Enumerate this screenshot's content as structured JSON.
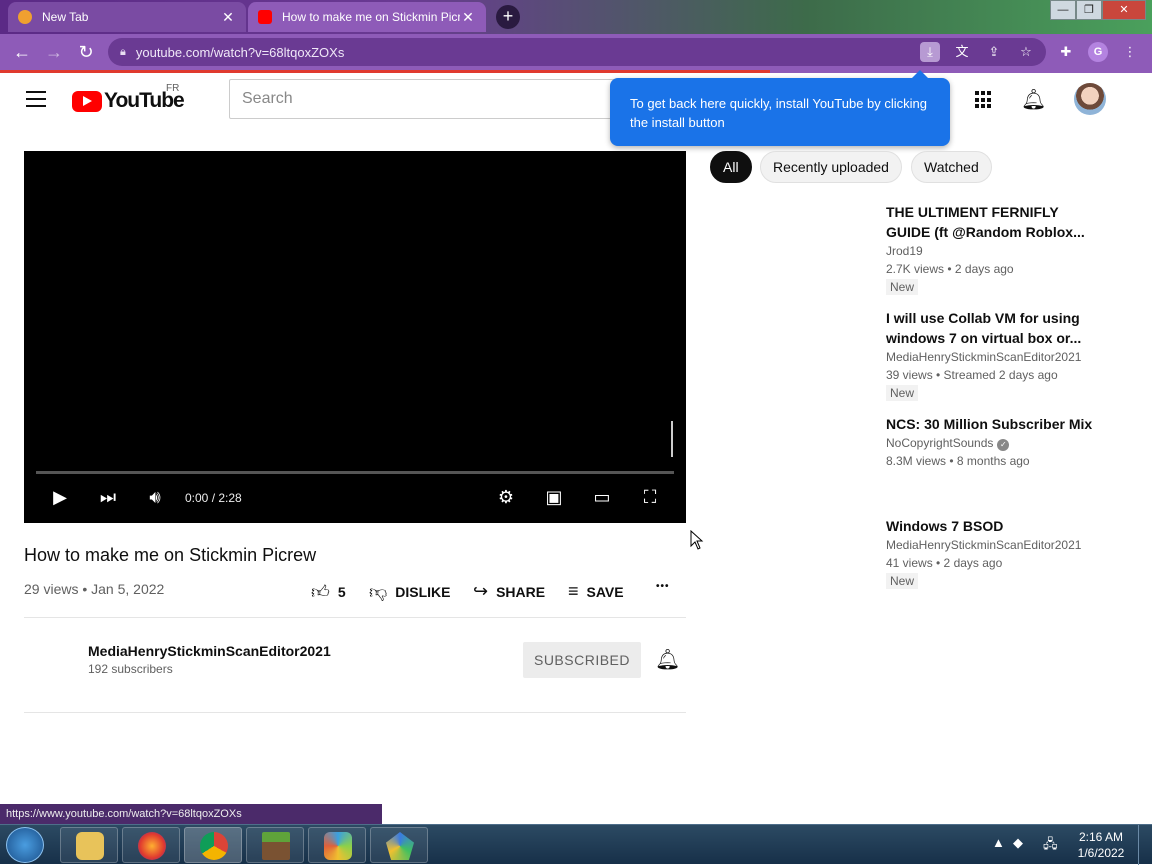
{
  "browser": {
    "tabs": [
      {
        "title": "New Tab"
      },
      {
        "title": "How to make me on Stickmin Picrew"
      }
    ],
    "url": "youtube.com/watch?v=68ltqoxZOXs",
    "hover_url": "https://www.youtube.com/watch?v=68ltqoxZOXs",
    "profile_initial": "G",
    "close_glyph": "✕",
    "plus_glyph": "+"
  },
  "youtube": {
    "logo_text": "YouTube",
    "country_code": "FR",
    "search_placeholder": "Search",
    "install_tip": "To get back here quickly, install YouTube by clicking the install button"
  },
  "player": {
    "time": "0:00 / 2:28"
  },
  "video": {
    "title": "How to make me on Stickmin Picrew",
    "meta": "29 views • Jan 5, 2022",
    "like_count": "5",
    "dislike_label": "DISLIKE",
    "share_label": "SHARE",
    "save_label": "SAVE",
    "more_glyph": "•••"
  },
  "channel": {
    "name": "MediaHenryStickminScanEditor2021",
    "subscribers": "192 subscribers",
    "subscribe_label": "SUBSCRIBED"
  },
  "chips": [
    "All",
    "Recently uploaded",
    "Watched"
  ],
  "recommendations": [
    {
      "title": "THE ULTIMENT FERNIFLY GUIDE (ft @Random Roblox...",
      "channel": "Jrod19",
      "stats": "2.7K views • 2 days ago",
      "badge": "New"
    },
    {
      "title": "I will use Collab VM for using windows 7 on virtual box or...",
      "channel": "MediaHenryStickminScanEditor2021",
      "stats": "39 views • Streamed 2 days ago",
      "badge": "New"
    },
    {
      "title": "NCS: 30 Million Subscriber Mix",
      "channel": "NoCopyrightSounds",
      "stats": "8.3M views • 8 months ago",
      "badge": ""
    },
    {
      "title": "Windows 7 BSOD",
      "channel": "MediaHenryStickminScanEditor2021",
      "stats": "41 views • 2 days ago",
      "badge": "New"
    }
  ],
  "taskbar": {
    "time": "2:16 AM",
    "date": "1/6/2022"
  }
}
